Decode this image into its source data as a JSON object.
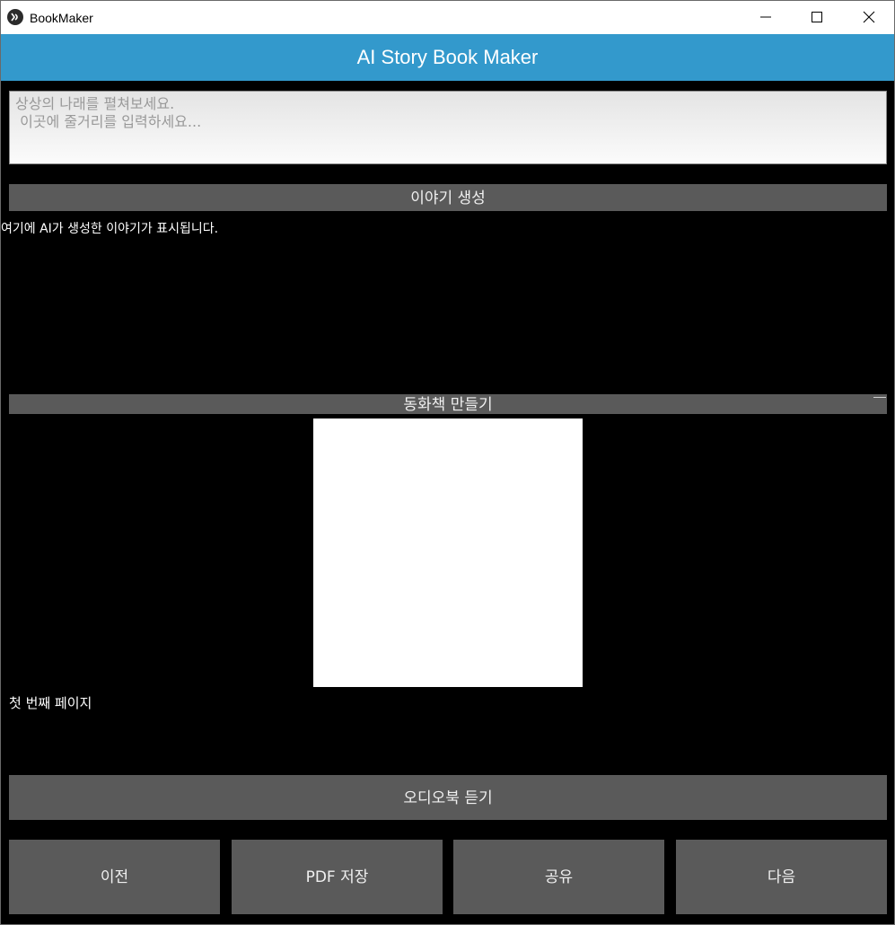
{
  "window": {
    "title": "BookMaker",
    "icons": {
      "app": "kivy-app-icon",
      "minimize": "minimize-icon",
      "maximize": "maximize-icon",
      "close": "close-icon"
    }
  },
  "header": {
    "title": "AI Story Book Maker",
    "color": "#3399cc"
  },
  "story_input": {
    "value": "",
    "placeholder": "상상의 나래를 펼쳐보세요.\n 이곳에 줄거리를 입력하세요..."
  },
  "buttons": {
    "generate_story": "이야기 생성",
    "make_book": "동화책 만들기",
    "audiobook": "오디오북 듣기",
    "prev": "이전",
    "save_pdf": "PDF 저장",
    "share": "공유",
    "next": "다음"
  },
  "story_output": {
    "text": "여기에 AI가 생성한 이야기가 표시됩니다."
  },
  "book_page": {
    "text": "첫 번째 페이지"
  }
}
